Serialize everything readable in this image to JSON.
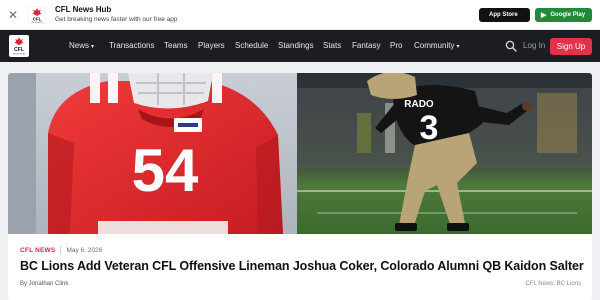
{
  "app_banner": {
    "close_glyph": "✕",
    "title": "CFL News Hub",
    "subtitle": "Get breaking news faster with our free app",
    "logo_text": "CFL",
    "logo_sub": "NEWS HUB",
    "app_store_label": "App Store",
    "google_play_label": "Google Play"
  },
  "nav": {
    "logo_text": "CFL",
    "logo_sub": "NEWS HUB",
    "items": [
      {
        "label": "News",
        "dropdown": true
      },
      {
        "label": "Transactions",
        "dropdown": false
      },
      {
        "label": "Teams",
        "dropdown": false
      },
      {
        "label": "Players",
        "dropdown": false
      },
      {
        "label": "Schedule",
        "dropdown": false
      },
      {
        "label": "Standings",
        "dropdown": false
      },
      {
        "label": "Stats",
        "dropdown": false
      },
      {
        "label": "Fantasy",
        "dropdown": false
      },
      {
        "label": "Pro",
        "dropdown": false
      },
      {
        "label": "Community",
        "dropdown": true
      }
    ],
    "login_label": "Log In",
    "signup_label": "Sign Up",
    "colors": {
      "background": "#1b1d22",
      "accent": "#e0344a"
    }
  },
  "article": {
    "category": "CFL NEWS",
    "date": "May 6, 2026",
    "headline": "BC Lions Add Veteran CFL Offensive Lineman Joshua Coker, Colorado Alumni QB Kaidon Salter",
    "byline": "By Jonathan Clink",
    "tags": "CFL News, BC Lions",
    "hero_left": {
      "jersey_number": "54"
    },
    "hero_right": {
      "jersey_number": "3",
      "jersey_text": "RADO"
    }
  }
}
